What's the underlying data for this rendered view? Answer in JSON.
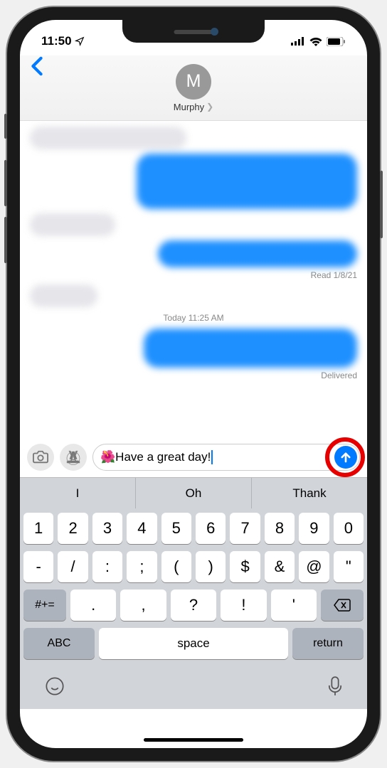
{
  "status": {
    "time": "11:50",
    "location_icon": "➤"
  },
  "header": {
    "avatar_initial": "M",
    "contact_name": "Murphy"
  },
  "messages": {
    "read_status": "Read 1/8/21",
    "timestamp": "Today 11:25 AM",
    "delivered": "Delivered"
  },
  "input": {
    "emoji": "🌺",
    "text": " Have a great day!"
  },
  "suggestions": [
    "I",
    "Oh",
    "Thank"
  ],
  "keyboard": {
    "row1": [
      "1",
      "2",
      "3",
      "4",
      "5",
      "6",
      "7",
      "8",
      "9",
      "0"
    ],
    "row2": [
      "-",
      "/",
      ":",
      ";",
      "(",
      ")",
      "$",
      "&",
      "@",
      "\""
    ],
    "row3_fn": "#+=",
    "row3_keys": [
      ".",
      ",",
      "?",
      "!",
      "'"
    ],
    "abc": "ABC",
    "space": "space",
    "return": "return"
  }
}
